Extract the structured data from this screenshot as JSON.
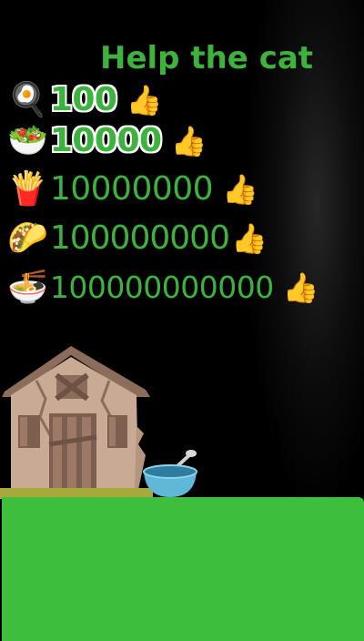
{
  "title": "Help the cat",
  "rows": [
    {
      "food_icon": "fried-egg-icon",
      "food": "🍳",
      "amount": "100",
      "thumb": "👍"
    },
    {
      "food_icon": "salad-icon",
      "food": "🥗",
      "amount": "10000",
      "thumb": "👍"
    },
    {
      "food_icon": "fries-icon",
      "food": "🍟",
      "amount": "10000000",
      "thumb": "👍"
    },
    {
      "food_icon": "taco-icon",
      "food": "🌮",
      "amount": "100000000",
      "thumb": "👍"
    },
    {
      "food_icon": "ramen-icon",
      "food": "🍜",
      "amount": "100000000000",
      "thumb": "👍"
    }
  ],
  "scene": {
    "cat": "😿",
    "ground_color": "#3dbe3d",
    "title_color": "#3db23d",
    "accent_green": "#3cb33c"
  }
}
